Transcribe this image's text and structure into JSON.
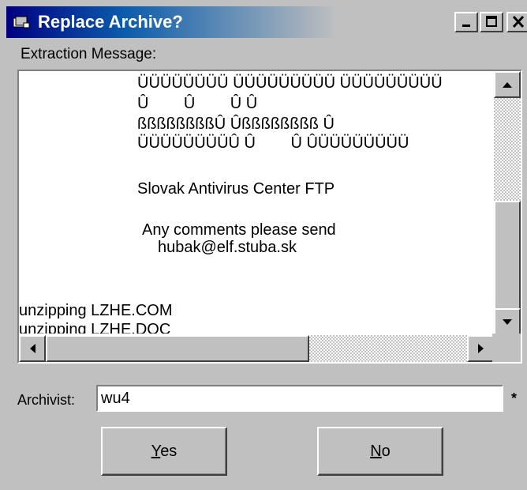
{
  "window": {
    "title": "Replace Archive?",
    "message_label": "Extraction Message:"
  },
  "message": {
    "lines": [
      "ÜÜÜÜÜÜÜÜ ÜÜÜÜÜÜÜÜÜ ÜÜÜÜÜÜÜÜÜ",
      "Û        Û        Û Û",
      "ßßßßßßßßÛ Ûßßßßßßßß Û",
      "ÜÜÜÜÜÜÜÜÛ Û        Û ÛÜÜÜÜÜÜÜÜ",
      "Slovak Antivirus Center FTP",
      "Any comments please send",
      "hubak@elf.stuba.sk",
      "unzipping LZHE.COM",
      "unzipping LZHE.DOC"
    ]
  },
  "archivist": {
    "label": "Archivist:",
    "value": "wu4",
    "required_marker": "*"
  },
  "buttons": {
    "yes_label": "Yes",
    "no_label": "No"
  }
}
